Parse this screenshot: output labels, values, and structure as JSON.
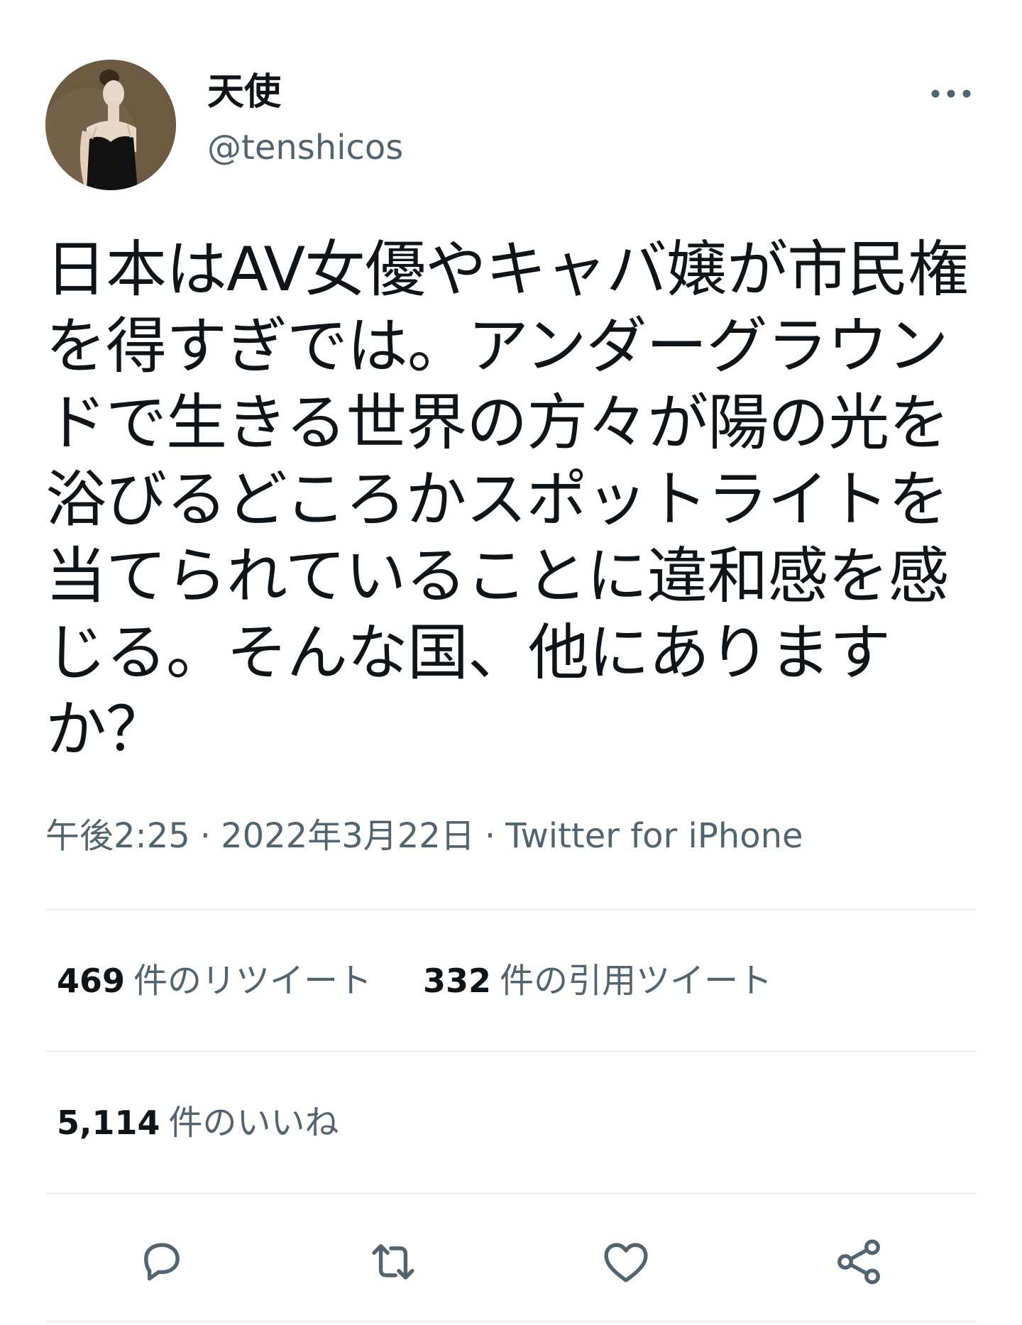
{
  "author": {
    "display_name": "天使",
    "handle": "@tenshicos"
  },
  "tweet": {
    "text": "日本はAV女優やキャバ嬢が市民権を得すぎでは。アンダーグラウンドで生きる世界の方々が陽の光を浴びるどころかスポットライトを当てられていることに違和感を感じる。そんな国、他にありますか？",
    "time": "午後2:25",
    "date": "2022年3月22日",
    "separator": "·",
    "source": "Twitter for iPhone"
  },
  "stats": {
    "retweets_count": "469",
    "retweets_label": "件のリツイート",
    "quotes_count": "332",
    "quotes_label": "件の引用ツイート",
    "likes_count": "5,114",
    "likes_label": "件のいいね"
  },
  "icons": {
    "more": "more-horizontal-icon",
    "reply": "reply-icon",
    "retweet": "retweet-icon",
    "like": "heart-icon",
    "share": "share-icon"
  },
  "colors": {
    "text_primary": "#0f1419",
    "text_secondary": "#536471",
    "divider": "#eff3f4"
  }
}
